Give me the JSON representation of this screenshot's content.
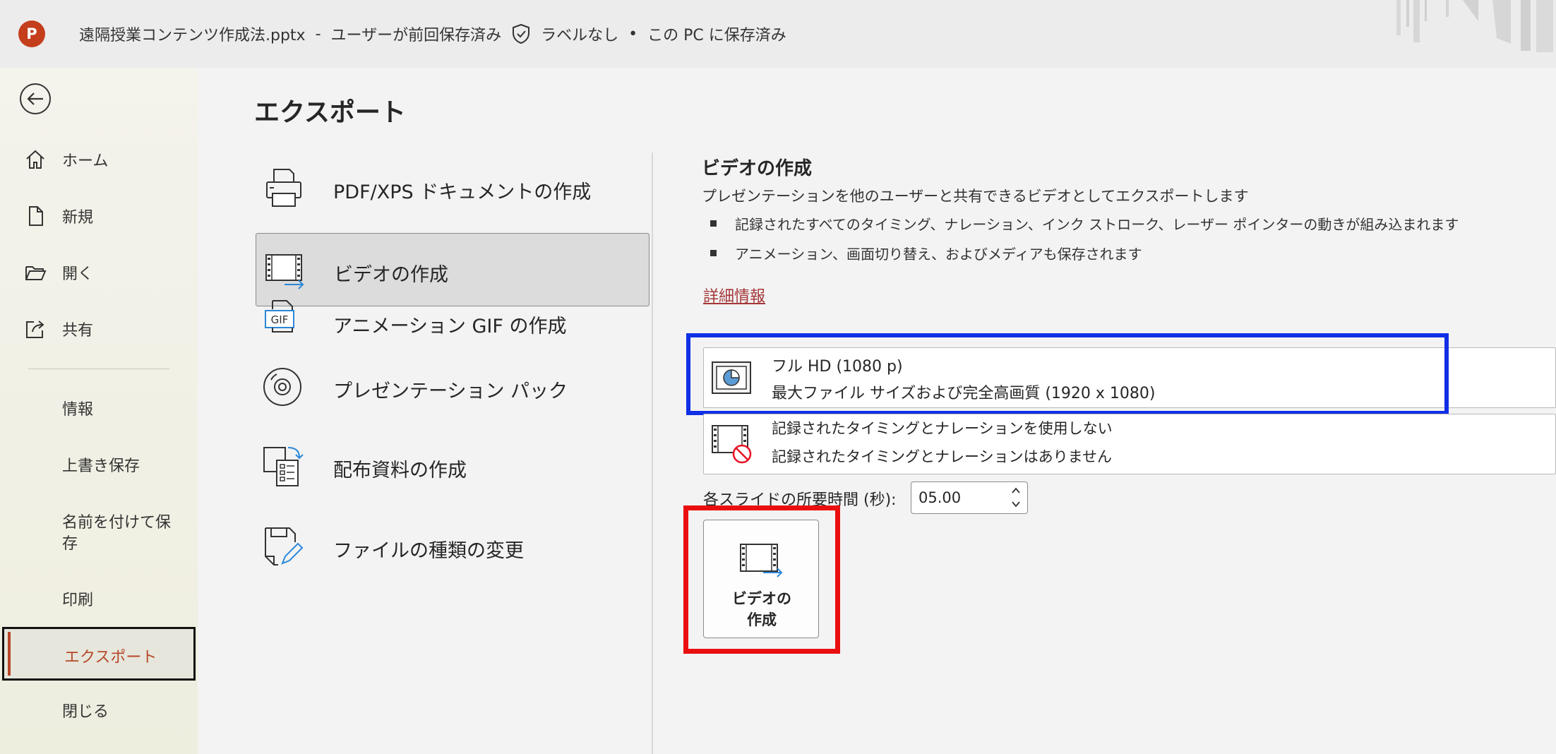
{
  "titlebar": {
    "app_initial": "P",
    "filename": "遠隔授業コンテンツ作成法.pptx",
    "separator": "-",
    "save_status": "ユーザーが前回保存済み",
    "label_status": "ラベルなし",
    "bullet": "•",
    "location": "この PC に保存済み"
  },
  "nav": {
    "home": "ホーム",
    "new": "新規",
    "open": "開く",
    "share": "共有",
    "info": "情報",
    "save": "上書き保存",
    "save_as_line1": "名前を付けて保",
    "save_as_line2": "存",
    "print": "印刷",
    "export": "エクスポート",
    "close": "閉じる"
  },
  "main": {
    "title": "エクスポート",
    "options": [
      {
        "label": "PDF/XPS ドキュメントの作成"
      },
      {
        "label": "ビデオの作成"
      },
      {
        "label": "アニメーション GIF の作成"
      },
      {
        "label": "プレゼンテーション パック"
      },
      {
        "label": "配布資料の作成"
      },
      {
        "label": "ファイルの種類の変更"
      }
    ],
    "gif_badge": "GIF"
  },
  "video": {
    "title": "ビデオの作成",
    "description": "プレゼンテーションを他のユーザーと共有できるビデオとしてエクスポートします",
    "bullets": [
      "記録されたすべてのタイミング、ナレーション、インク ストローク、レーザー ポインターの動きが組み込まれます",
      "アニメーション、画面切り替え、およびメディアも保存されます"
    ],
    "learn_more": "詳細情報",
    "quality": {
      "line1": "フル HD (1080 p)",
      "line2": "最大ファイル サイズおよび完全高画質 (1920 x 1080)"
    },
    "timing": {
      "line1": "記録されたタイミングとナレーションを使用しない",
      "line2": "記録されたタイミングとナレーションはありません"
    },
    "duration_label": "各スライドの所要時間 (秒):",
    "duration_value": "05.00",
    "create_button_line1": "ビデオの",
    "create_button_line2": "作成"
  },
  "colors": {
    "accent": "#b7472a",
    "link": "#a4373a",
    "highlight_blue": "#0f2fe6",
    "highlight_red": "#ea0f0f"
  }
}
